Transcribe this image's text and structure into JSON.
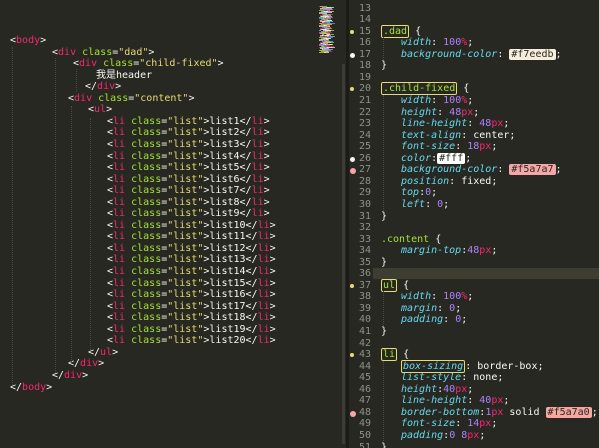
{
  "html_code": {
    "body_open": "body",
    "dad_div": {
      "tag": "div",
      "attr": "class",
      "value": "\"dad\""
    },
    "child_div": {
      "tag": "div",
      "attr": "class",
      "value": "\"child-fixed\""
    },
    "header_text": "我是header",
    "close_div": "div",
    "content_div": {
      "tag": "div",
      "attr": "class",
      "value": "\"content\""
    },
    "ul_open": "ul",
    "ul_close": "ul",
    "body_close": "body",
    "list_items": [
      "list1",
      "list2",
      "list3",
      "list4",
      "list5",
      "list6",
      "list7",
      "list8",
      "list9",
      "list10",
      "list11",
      "list12",
      "list13",
      "list14",
      "list15",
      "list16",
      "list17",
      "list18",
      "list19",
      "list20"
    ],
    "li_tag": "li",
    "li_attr": "class",
    "li_value": "\"list\""
  },
  "css_code": {
    "line_numbers": [
      "13",
      "14",
      "15",
      "16",
      "17",
      "18",
      "19",
      "20",
      "21",
      "22",
      "23",
      "24",
      "25",
      "26",
      "27",
      "28",
      "29",
      "30",
      "31",
      "32",
      "33",
      "34",
      "35",
      "36",
      "37",
      "38",
      "39",
      "40",
      "41",
      "42",
      "43",
      "44",
      "45",
      "46",
      "47",
      "48",
      "49",
      "50",
      "51"
    ],
    "dad": {
      "selector": ".dad",
      "width_prop": "width",
      "width_val": "100%",
      "bg_prop": "background-color",
      "bg_val": "#f7eedb",
      "bg_color": "#f7eedb"
    },
    "child_fixed": {
      "selector": ".child-fixed",
      "props": [
        {
          "p": "width",
          "v": "100%"
        },
        {
          "p": "height",
          "v": "48px"
        },
        {
          "p": "line-height",
          "v": "48px"
        },
        {
          "p": "text-align",
          "v": "center"
        },
        {
          "p": "font-size",
          "v": "18px"
        }
      ],
      "color_prop": "color",
      "color_val": "#fff",
      "color_swatch": "#ffffff",
      "bg_prop": "background-color",
      "bg_val": "#f5a7a7",
      "bg_swatch": "#f5a7a7",
      "pos_prop": "position",
      "pos_val": "fixed",
      "top_prop": "top",
      "top_val": "0",
      "left_prop": "left",
      "left_val": "0"
    },
    "content": {
      "selector": ".content",
      "prop": "margin-top",
      "val": "48px"
    },
    "ul": {
      "selector": "ul",
      "props": [
        {
          "p": "width",
          "v": "100%"
        },
        {
          "p": "margin",
          "v": "0"
        },
        {
          "p": "padding",
          "v": "0"
        }
      ]
    },
    "li": {
      "selector": "li",
      "box_prop": "box-sizing",
      "box_val": "border-box",
      "ls_prop": "list-style",
      "ls_val": "none",
      "h_prop": "height",
      "h_val": "40px",
      "lh_prop": "line-height",
      "lh_val": "40px",
      "bb_prop": "border-bottom",
      "bb_val1": "1px solid ",
      "bb_val2": "#f5a7a0",
      "bb_swatch": "#f5a7a0",
      "fs_prop": "font-size",
      "fs_val": "14px",
      "pad_prop": "padding",
      "pad_val": "0 8px"
    }
  },
  "colors": {
    "background": "#272822",
    "tag": "#f92672",
    "attr": "#a6e22e",
    "string": "#e6db74",
    "property": "#66d9ef",
    "number": "#ae81ff"
  }
}
